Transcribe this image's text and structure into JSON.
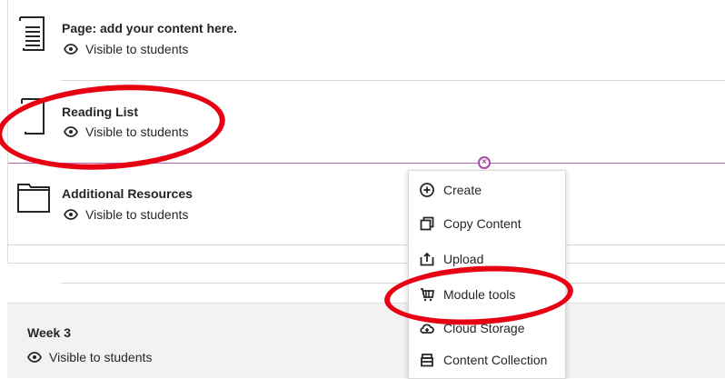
{
  "items": [
    {
      "title": "Page: add your content here.",
      "visibility": "Visible to students"
    },
    {
      "title": "Reading List",
      "visibility": "Visible to students"
    },
    {
      "title": "Additional Resources",
      "visibility": "Visible to students"
    }
  ],
  "week": {
    "title": "Week 3",
    "visibility": "Visible to students"
  },
  "menu": {
    "items": [
      {
        "label": "Create",
        "icon": "plus-circle-icon"
      },
      {
        "label": "Copy Content",
        "icon": "copy-icon"
      },
      {
        "label": "Upload",
        "icon": "upload-icon"
      },
      {
        "label": "Module tools",
        "icon": "cart-icon"
      },
      {
        "label": "Cloud Storage",
        "icon": "cloud-icon"
      },
      {
        "label": "Content Collection",
        "icon": "stack-icon"
      }
    ]
  },
  "colors": {
    "annotation": "#e60012",
    "divider_accent": "#a64ca6"
  }
}
